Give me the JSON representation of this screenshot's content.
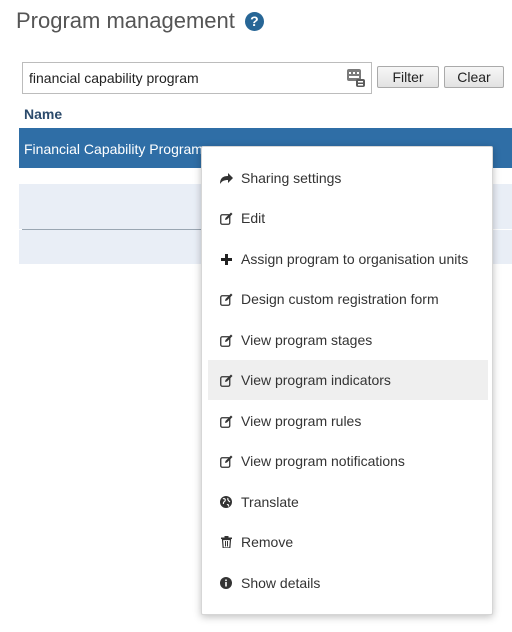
{
  "page": {
    "title": "Program management",
    "help_icon": "?"
  },
  "search": {
    "value": "financial capability program",
    "filter_label": "Filter",
    "clear_label": "Clear"
  },
  "table": {
    "column_name": "Name",
    "rows": [
      {
        "name": "Financial Capability Program"
      }
    ]
  },
  "context_menu": {
    "items": [
      {
        "label": "Sharing settings",
        "icon": "share-icon"
      },
      {
        "label": "Edit",
        "icon": "edit-icon"
      },
      {
        "label": "Assign program to organisation units",
        "icon": "plus-icon"
      },
      {
        "label": "Design custom registration form",
        "icon": "edit-icon"
      },
      {
        "label": "View program stages",
        "icon": "edit-icon"
      },
      {
        "label": "View program indicators",
        "icon": "edit-icon"
      },
      {
        "label": "View program rules",
        "icon": "edit-icon"
      },
      {
        "label": "View program notifications",
        "icon": "edit-icon"
      },
      {
        "label": "Translate",
        "icon": "globe-icon"
      },
      {
        "label": "Remove",
        "icon": "trash-icon"
      },
      {
        "label": "Show details",
        "icon": "info-icon"
      }
    ],
    "hovered_item": "View program indicators"
  },
  "colors": {
    "selected_row": "#2f6ea6",
    "help_icon": "#276696"
  }
}
